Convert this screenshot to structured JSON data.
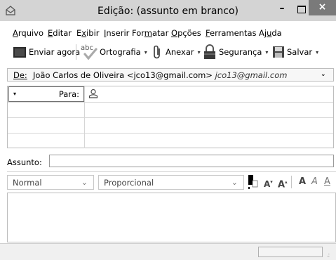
{
  "window": {
    "title": "Edição: (assunto em branco)",
    "minimize_glyph": "–",
    "close_glyph": "×"
  },
  "menu": [
    "Arquivo",
    "Editar",
    "Exibir",
    "Inserir",
    "Formatar",
    "Opções",
    "Ferramentas",
    "Ajuda"
  ],
  "toolbar": {
    "send_label": "Enviar agora",
    "spelling_label": "Ortografia",
    "attach_label": "Anexar",
    "security_label": "Segurança",
    "save_label": "Salvar"
  },
  "from": {
    "label": "De:",
    "name_address": "João Carlos de Oliveira <jco13@gmail.com>",
    "account": "jco13@gmail.com"
  },
  "recipients": {
    "type_label": "Para:"
  },
  "subject": {
    "label": "Assunto:",
    "value": ""
  },
  "format": {
    "paragraph_style": "Normal",
    "font": "Proporcional",
    "smaller_label": "A",
    "larger_label": "A",
    "bold_label": "A",
    "italic_label": "A",
    "underline_label": "A"
  }
}
